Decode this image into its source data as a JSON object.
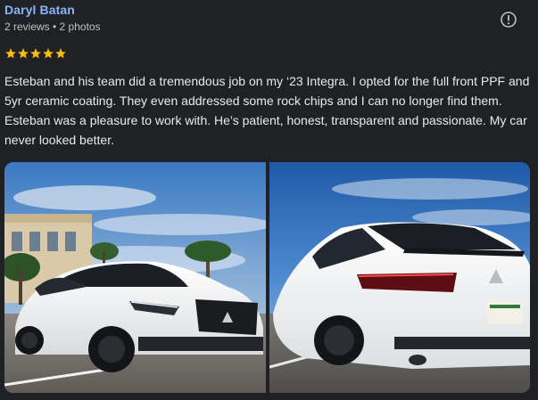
{
  "reviewer": {
    "name": "Daryl Batan",
    "meta": "2 reviews • 2 photos"
  },
  "rating": {
    "stars": 5,
    "star_color": "#fbbc04"
  },
  "review": {
    "text": "Esteban and his team did a tremendous job on my ‘23 Integra. I opted for the full front PPF and 5yr ceramic coating. They even addressed some rock chips and I can no longer find them. Esteban was a pleasure to work with. He’s patient, honest, transparent and passionate. My car never looked better."
  },
  "photos": [
    {
      "subject": "front-three-quarter view of white car with palm trees"
    },
    {
      "subject": "rear three-quarter view of white car under blue sky"
    }
  ],
  "icons": {
    "report": "report-icon",
    "star": "star-icon"
  },
  "colors": {
    "background": "#202124",
    "name": "#8ab4f8",
    "text": "#e8eaed",
    "meta": "#bdc1c6"
  }
}
